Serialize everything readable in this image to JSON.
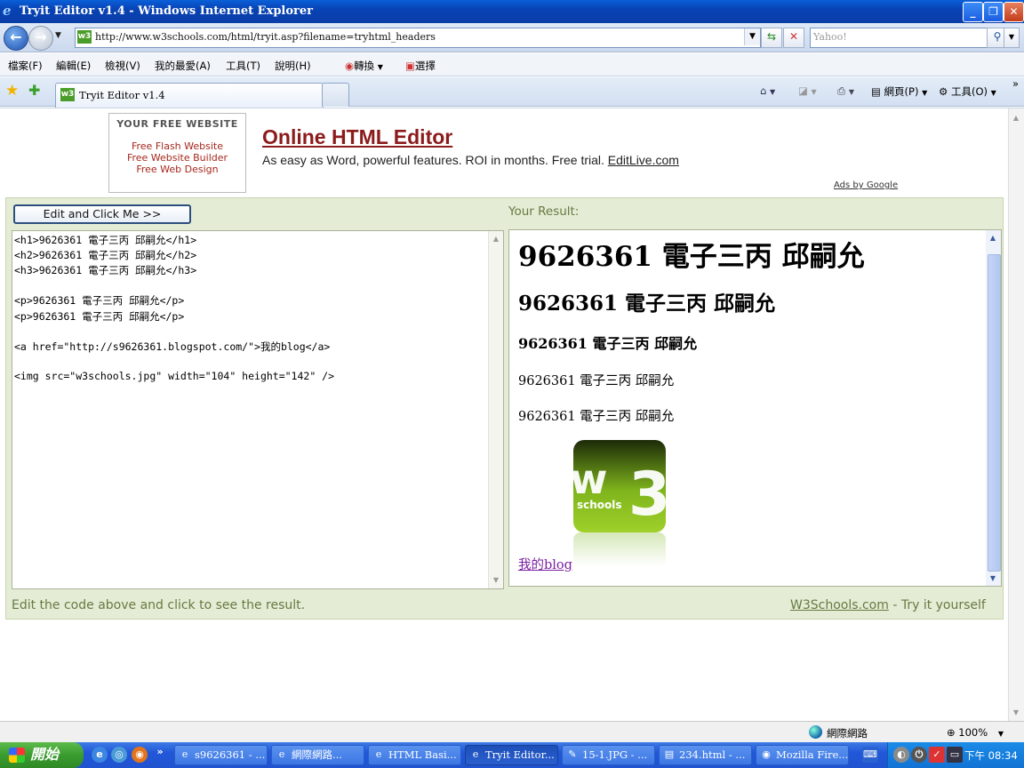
{
  "window": {
    "title": "Tryit Editor v1.4 - Windows Internet Explorer"
  },
  "address": {
    "url": "http://www.w3schools.com/html/tryit.asp?filename=tryhtml_headers",
    "search_placeholder": "Yahoo!"
  },
  "menu": {
    "items": [
      "檔案(F)",
      "編輯(E)",
      "檢視(V)",
      "我的最愛(A)",
      "工具(T)",
      "說明(H)"
    ],
    "convert": "轉換",
    "select": "選擇"
  },
  "tabs": {
    "active": "Tryit Editor v1.4"
  },
  "toolbar_right": {
    "page": "網頁(P)",
    "tools": "工具(O)"
  },
  "ad": {
    "box_title": "YOUR FREE WEBSITE",
    "links": [
      "Free Flash Website",
      "Free Website Builder",
      "Free Web Design"
    ],
    "headline": "Online HTML Editor",
    "desc": "As easy as Word, powerful features. ROI in months. Free trial.",
    "desc_link": "EditLive.com",
    "ads_by": "Ads by Google"
  },
  "tryit": {
    "button": "Edit and Click Me >>",
    "result_label": "Your Result:",
    "code_lines": [
      "<h1>9626361 電子三丙 邱嗣允</h1>",
      "<h2>9626361 電子三丙 邱嗣允</h2>",
      "<h3>9626361 電子三丙 邱嗣允</h3>",
      "",
      "<p>9626361 電子三丙 邱嗣允</p>",
      "<p>9626361 電子三丙 邱嗣允</p>",
      "",
      "<a href=\"http://s9626361.blogspot.com/\">我的blog</a>",
      "",
      "<img src=\"w3schools.jpg\" width=\"104\" height=\"142\" />"
    ],
    "result": {
      "h1": "9626361 電子三丙 邱嗣允",
      "h2": "9626361 電子三丙 邱嗣允",
      "h3": "9626361 電子三丙 邱嗣允",
      "p1": "9626361 電子三丙 邱嗣允",
      "p2": "9626361 電子三丙 邱嗣允",
      "image_text": "schools",
      "link": "我的blog"
    },
    "footer_note": "Edit the code above and click to see the result.",
    "footer_link": "W3Schools.com",
    "footer_suffix": " - Try it yourself"
  },
  "status": {
    "zone": "網際網路",
    "zoom": "100%"
  },
  "taskbar": {
    "start": "開始",
    "items": [
      "s9626361 - ...",
      "網際網路...",
      "HTML Basi...",
      "Tryit Editor...",
      "15-1.JPG - ...",
      "234.html - ...",
      "Mozilla Fire..."
    ],
    "clock": "下午 08:34"
  },
  "colors": {
    "accent": "#0842b4",
    "tryit_bg": "#e5ecd5",
    "ad_title": "#8c1b1b",
    "tryit_text": "#667a42"
  }
}
